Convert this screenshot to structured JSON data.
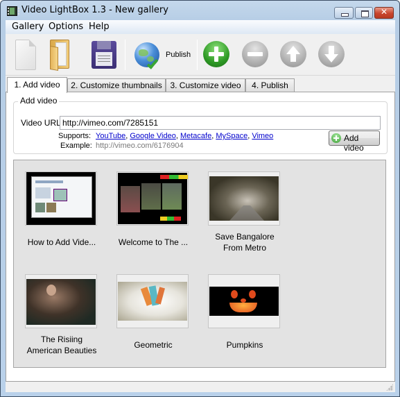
{
  "window": {
    "title": "Video LightBox 1.3  - New gallery",
    "controls": {
      "minimize": "minimize",
      "maximize": "maximize",
      "close": "close"
    }
  },
  "menu": {
    "items": [
      {
        "label": "Gallery"
      },
      {
        "label": "Options"
      },
      {
        "label": "Help"
      }
    ]
  },
  "toolbar": {
    "buttons": [
      {
        "name": "new",
        "icon": "document-icon"
      },
      {
        "name": "open",
        "icon": "folder-icon"
      },
      {
        "name": "save",
        "icon": "floppy-disk-icon"
      },
      {
        "name": "publish",
        "icon": "globe-check-icon",
        "label": "Publish"
      },
      {
        "name": "add",
        "icon": "plus-circle-icon",
        "enabled": true
      },
      {
        "name": "remove",
        "icon": "minus-circle-icon",
        "enabled": false
      },
      {
        "name": "move-up",
        "icon": "arrow-up-circle-icon",
        "enabled": false
      },
      {
        "name": "move-down",
        "icon": "arrow-down-circle-icon",
        "enabled": false
      }
    ],
    "publish_label": "Publish"
  },
  "tabs": [
    {
      "label": "1. Add video",
      "active": true
    },
    {
      "label": "2. Customize thumbnails",
      "active": false
    },
    {
      "label": "3. Customize video",
      "active": false
    },
    {
      "label": "4. Publish",
      "active": false
    }
  ],
  "add_video": {
    "group_title": "Add video",
    "url_label": "Video URL",
    "url_value": "http://vimeo.com/7285151",
    "supports_label": "Supports:",
    "supports": [
      "YouTube",
      "Google Video",
      "Metacafe",
      "MySpace",
      "Vimeo"
    ],
    "example_label": "Example:",
    "example_value": "http://vimeo.com/6176904",
    "add_button": "Add video"
  },
  "gallery": {
    "items": [
      {
        "caption": "How to Add Vide...",
        "thumb": "screenshot"
      },
      {
        "caption": "Welcome to The ...",
        "thumb": "sports"
      },
      {
        "caption": "Save Bangalore\nFrom Metro",
        "caption_lines": [
          "Save Bangalore",
          "From Metro"
        ],
        "thumb": "tree-road"
      },
      {
        "caption": "The Risiing\nAmerican Beauties",
        "caption_lines": [
          "The Risiing",
          "American Beauties"
        ],
        "thumb": "archer"
      },
      {
        "caption": "Geometric",
        "thumb": "geometric"
      },
      {
        "caption": "Pumpkins",
        "thumb": "pumpkin"
      }
    ]
  }
}
